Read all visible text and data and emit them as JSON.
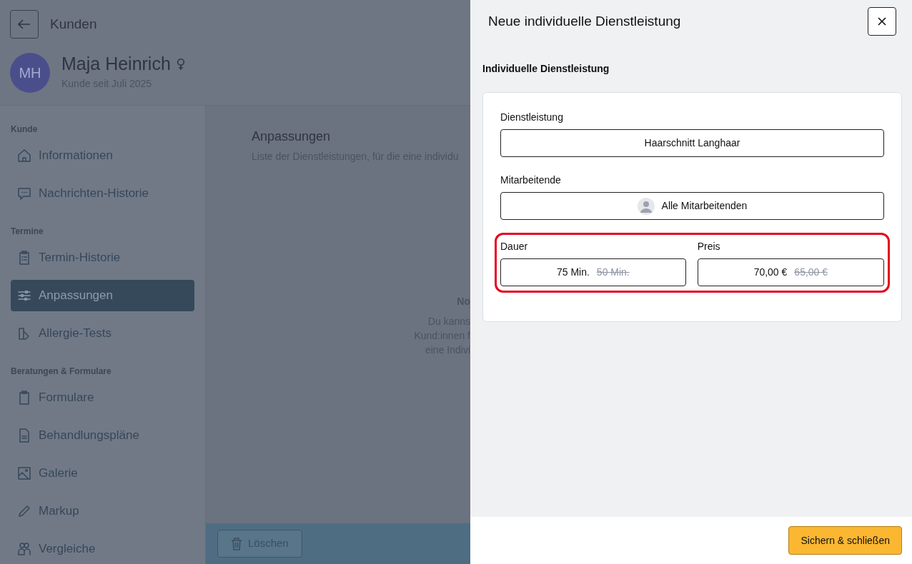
{
  "header": {
    "back_label": "Kunden"
  },
  "customer": {
    "initials": "MH",
    "name": "Maja Heinrich",
    "since": "Kunde seit Juli 2025"
  },
  "sidebar": {
    "sections": [
      {
        "title": "Kunde",
        "items": [
          {
            "label": "Informationen",
            "selected": false
          },
          {
            "label": "Nachrichten-Historie",
            "selected": false
          }
        ]
      },
      {
        "title": "Termine",
        "items": [
          {
            "label": "Termin-Historie",
            "selected": false
          },
          {
            "label": "Anpassungen",
            "selected": true
          },
          {
            "label": "Allergie-Tests",
            "selected": false
          }
        ]
      },
      {
        "title": "Beratungen & Formulare",
        "items": [
          {
            "label": "Formulare",
            "selected": false
          },
          {
            "label": "Behandlungspläne",
            "selected": false
          },
          {
            "label": "Galerie",
            "selected": false
          },
          {
            "label": "Markup",
            "selected": false
          },
          {
            "label": "Vergleiche",
            "selected": false
          }
        ]
      }
    ]
  },
  "main": {
    "title": "Anpassungen",
    "subtitle": "Liste der Dienstleistungen, für die eine individu",
    "empty_state": {
      "title": "No",
      "lines": [
        "Du kanns",
        "Kund:innen f",
        "eine Indivi"
      ]
    },
    "delete_button": "Löschen"
  },
  "panel": {
    "title": "Neue individuelle Dienstleistung",
    "section_label": "Individuelle Dienstleistung",
    "fields": [
      {
        "label": "Dienstleistung",
        "value": "Haarschnitt Langhaar",
        "kind": "plain"
      },
      {
        "label": "Mitarbeitende",
        "value": "Alle Mitarbeitenden",
        "kind": "staff"
      }
    ],
    "adjustments": {
      "highlighted": true,
      "fields": [
        {
          "label": "Dauer",
          "value": "75 Min.",
          "original": "50 Min."
        },
        {
          "label": "Preis",
          "value": "70,00 €",
          "original": "65,00 €"
        }
      ]
    },
    "save_button": "Sichern & schließen"
  }
}
